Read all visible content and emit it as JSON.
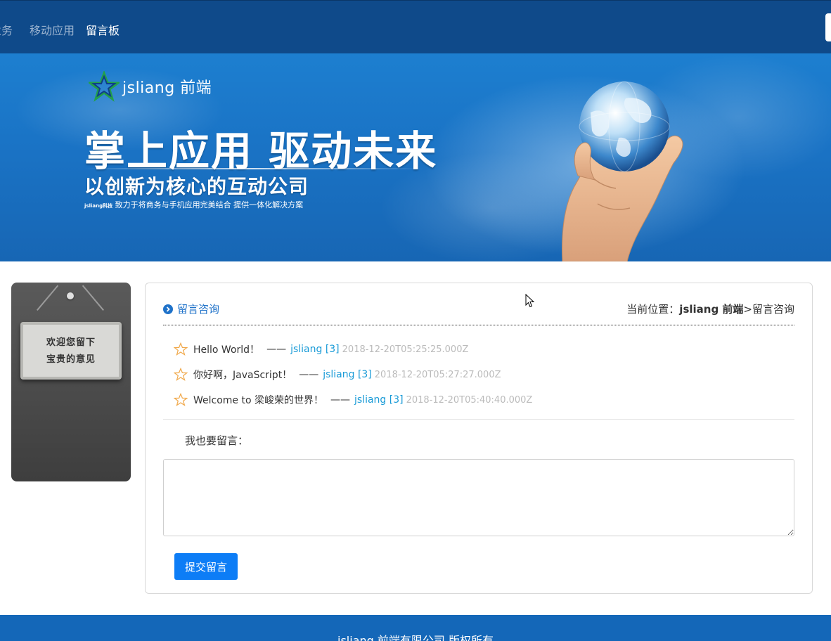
{
  "nav": {
    "items": [
      {
        "label": "业务",
        "active": false
      },
      {
        "label": "移动应用",
        "active": false
      },
      {
        "label": "留言板",
        "active": true
      }
    ]
  },
  "banner": {
    "logo_text": "jsliang 前端",
    "headline": "掌上应用  驱动未来",
    "subheadline": "以创新为核心的互动公司",
    "tagline_brand": "jsliang科技",
    "tagline": "致力于将商务与手机应用完美结合  提供一体化解决方案"
  },
  "sign": {
    "line1": "欢迎您留下",
    "line2": "宝贵的意见"
  },
  "panel": {
    "section_title": "留言咨询",
    "breadcrumb_prefix": "当前位置：",
    "breadcrumb_home": "jsliang 前端",
    "breadcrumb_current": ">留言咨询"
  },
  "messages": [
    {
      "content": "Hello World！",
      "dash": "——",
      "author": "jsliang [3]",
      "time": "2018-12-20T05:25:25.000Z"
    },
    {
      "content": "你好啊，JavaScript！",
      "dash": "——",
      "author": "jsliang [3]",
      "time": "2018-12-20T05:27:27.000Z"
    },
    {
      "content": "Welcome to 梁峻荣的世界！",
      "dash": "——",
      "author": "jsliang [3]",
      "time": "2018-12-20T05:40:40.000Z"
    }
  ],
  "compose": {
    "label": "我也要留言：",
    "value": "",
    "submit_label": "提交留言"
  },
  "footer": {
    "text": "jsliang 前端有限公司 版权所有"
  },
  "colors": {
    "nav_bg": "#0f4a8a",
    "banner_bg": "#1a73c5",
    "accent": "#1f72c9",
    "author": "#1a9bd7",
    "submit": "#0d7df6",
    "footer_bg": "#1467b8"
  }
}
